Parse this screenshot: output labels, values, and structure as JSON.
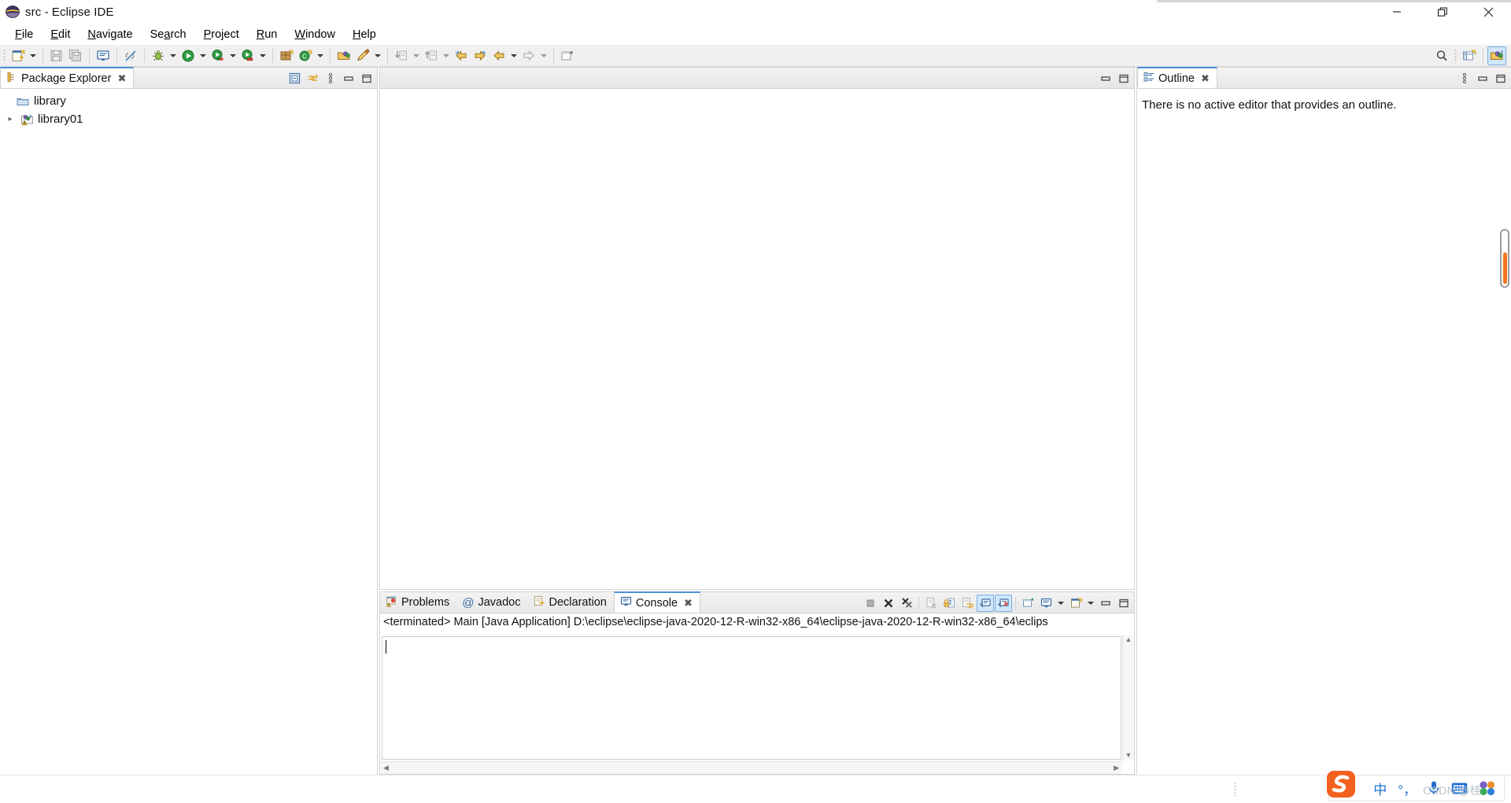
{
  "window": {
    "title": "src - Eclipse IDE",
    "logo_icon": "eclipse-logo-icon",
    "controls": {
      "minimize": "minimize-icon",
      "restore": "restore-icon",
      "close": "close-icon"
    }
  },
  "menubar": {
    "items": [
      {
        "label": "File",
        "mnemonic": "F"
      },
      {
        "label": "Edit",
        "mnemonic": "E"
      },
      {
        "label": "Navigate",
        "mnemonic": "N"
      },
      {
        "label": "Search",
        "mnemonic": "a"
      },
      {
        "label": "Project",
        "mnemonic": "P"
      },
      {
        "label": "Run",
        "mnemonic": "R"
      },
      {
        "label": "Window",
        "mnemonic": "W"
      },
      {
        "label": "Help",
        "mnemonic": "H"
      }
    ]
  },
  "toolbar": {
    "buttons": [
      {
        "name": "new-icon",
        "tooltip": "New",
        "has_dropdown": true
      },
      {
        "name": "save-icon",
        "tooltip": "Save",
        "has_dropdown": false
      },
      {
        "name": "save-all-icon",
        "tooltip": "Save All",
        "has_dropdown": false
      },
      {
        "name": "console-toggle-icon",
        "tooltip": "Open Console",
        "has_dropdown": false
      },
      {
        "name": "link-broken-icon",
        "tooltip": "Toggle Mark Occurrences",
        "has_dropdown": false
      },
      {
        "name": "debug-icon",
        "tooltip": "Debug",
        "has_dropdown": true
      },
      {
        "name": "run-icon",
        "tooltip": "Run",
        "has_dropdown": true
      },
      {
        "name": "run-external-tools-icon",
        "tooltip": "External Tools",
        "has_dropdown": true
      },
      {
        "name": "coverage-icon",
        "tooltip": "Coverage",
        "has_dropdown": true
      },
      {
        "name": "new-package-icon",
        "tooltip": "New Java Package",
        "has_dropdown": false
      },
      {
        "name": "new-class-icon",
        "tooltip": "New Java Class",
        "has_dropdown": true
      },
      {
        "name": "open-type-icon",
        "tooltip": "Open Type",
        "has_dropdown": false
      },
      {
        "name": "new-annotation-icon",
        "tooltip": "New Annotation",
        "has_dropdown": true
      },
      {
        "name": "next-annotation-icon",
        "tooltip": "Next Annotation",
        "has_dropdown": true
      },
      {
        "name": "previous-annotation-icon",
        "tooltip": "Previous Annotation",
        "has_dropdown": true
      },
      {
        "name": "back-icon",
        "tooltip": "Back",
        "has_dropdown": false
      },
      {
        "name": "forward-icon",
        "tooltip": "Forward",
        "has_dropdown": false
      },
      {
        "name": "previous-edit-icon",
        "tooltip": "Last Edit Location",
        "has_dropdown": true
      },
      {
        "name": "next-edit-icon",
        "tooltip": "Next Edit Location",
        "has_dropdown": true
      },
      {
        "name": "new-window-icon",
        "tooltip": "New Editor",
        "has_dropdown": false
      }
    ],
    "right_buttons": [
      {
        "name": "search-icon",
        "tooltip": "Search"
      },
      {
        "name": "open-perspective-icon",
        "tooltip": "Open Perspective"
      },
      {
        "name": "java-perspective-icon",
        "tooltip": "Java",
        "active": true
      }
    ]
  },
  "package_explorer": {
    "tab_label": "Package Explorer",
    "tab_icon": "package-explorer-icon",
    "close_icon": "close-tab-icon",
    "tools": [
      {
        "name": "collapse-all-icon",
        "tooltip": "Collapse All"
      },
      {
        "name": "link-with-editor-icon",
        "tooltip": "Link with Editor"
      },
      {
        "name": "view-menu-icon",
        "tooltip": "View Menu"
      },
      {
        "name": "minimize-panel-icon",
        "tooltip": "Minimize"
      },
      {
        "name": "maximize-panel-icon",
        "tooltip": "Maximize"
      }
    ],
    "tree": [
      {
        "label": "library",
        "icon": "folder-icon",
        "expandable": false,
        "indent": 1
      },
      {
        "label": "library01",
        "icon": "java-project-warning-icon",
        "expandable": true,
        "indent": 0
      }
    ]
  },
  "editor_area": {
    "tools": [
      {
        "name": "minimize-panel-icon",
        "tooltip": "Minimize"
      },
      {
        "name": "maximize-panel-icon",
        "tooltip": "Maximize"
      }
    ]
  },
  "bottom_panel": {
    "tabs": [
      {
        "label": "Problems",
        "icon": "problems-icon",
        "active": false
      },
      {
        "label": "Javadoc",
        "icon": "javadoc-icon",
        "active": false
      },
      {
        "label": "Declaration",
        "icon": "declaration-icon",
        "active": false
      },
      {
        "label": "Console",
        "icon": "console-icon",
        "active": true
      }
    ],
    "close_icon": "close-tab-icon",
    "tools": [
      {
        "name": "terminate-icon",
        "tooltip": "Terminate",
        "toggled": false,
        "dropdown": false
      },
      {
        "name": "remove-launch-icon",
        "tooltip": "Remove Launch",
        "toggled": false,
        "dropdown": false
      },
      {
        "name": "remove-all-terminated-icon",
        "tooltip": "Remove All Terminated Launches",
        "toggled": false,
        "dropdown": false
      },
      {
        "name": "clear-console-icon",
        "tooltip": "Clear Console",
        "toggled": false,
        "dropdown": false
      },
      {
        "name": "scroll-lock-icon",
        "tooltip": "Scroll Lock",
        "toggled": false,
        "dropdown": false
      },
      {
        "name": "word-wrap-icon",
        "tooltip": "Word Wrap",
        "toggled": false,
        "dropdown": false
      },
      {
        "name": "show-console-on-output-icon",
        "tooltip": "Show Console When Standard Out Changes",
        "toggled": true,
        "dropdown": false
      },
      {
        "name": "show-console-on-error-icon",
        "tooltip": "Show Console When Standard Error Changes",
        "toggled": true,
        "dropdown": false
      },
      {
        "name": "pin-console-icon",
        "tooltip": "Pin Console",
        "toggled": false,
        "dropdown": false
      },
      {
        "name": "display-selected-console-icon",
        "tooltip": "Display Selected Console",
        "toggled": false,
        "dropdown": true
      },
      {
        "name": "open-console-icon",
        "tooltip": "Open Console",
        "toggled": false,
        "dropdown": true
      },
      {
        "name": "minimize-panel-icon",
        "tooltip": "Minimize",
        "toggled": false,
        "dropdown": false
      },
      {
        "name": "maximize-panel-icon",
        "tooltip": "Maximize",
        "toggled": false,
        "dropdown": false
      }
    ],
    "console_header": "<terminated> Main [Java Application] D:\\eclipse\\eclipse-java-2020-12-R-win32-x86_64\\eclipse-java-2020-12-R-win32-x86_64\\eclips",
    "console_content": ""
  },
  "outline": {
    "tab_label": "Outline",
    "tab_icon": "outline-icon",
    "close_icon": "close-tab-icon",
    "tools": [
      {
        "name": "view-menu-icon",
        "tooltip": "View Menu"
      },
      {
        "name": "minimize-panel-icon",
        "tooltip": "Minimize"
      },
      {
        "name": "maximize-panel-icon",
        "tooltip": "Maximize"
      }
    ],
    "message": "There is no active editor that provides an outline."
  },
  "taskbar": {
    "ime": {
      "logo_icon": "sogou-logo-icon",
      "items": [
        {
          "name": "ime-mode-chinese",
          "label": "中"
        },
        {
          "name": "ime-punctuation",
          "label": "°，"
        },
        {
          "name": "ime-voice-input-icon",
          "label": ""
        },
        {
          "name": "ime-keyboard-icon",
          "label": ""
        },
        {
          "name": "ime-toolbox-icon",
          "label": ""
        }
      ]
    },
    "watermark": "CSDN @桂"
  },
  "colors": {
    "accent": "#4a90d9",
    "scroll_thumb": "#f7761f",
    "toolbar_bg": "#f0f0f0",
    "panel_border": "#d4d4d4"
  }
}
